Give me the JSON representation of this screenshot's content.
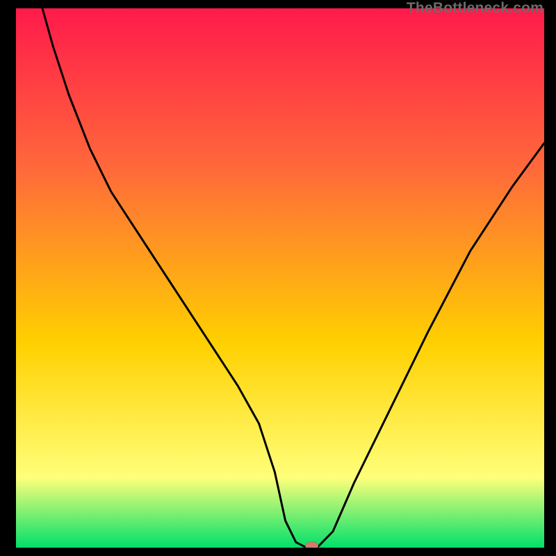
{
  "watermark": "TheBottleneck.com",
  "colors": {
    "gradient_top": "#ff1a4b",
    "gradient_mid1": "#ff6a3a",
    "gradient_mid2": "#ffd000",
    "gradient_mid3": "#ffff7a",
    "gradient_bottom": "#00e06a",
    "curve": "#000000",
    "marker_fill": "#d6796f",
    "marker_stroke": "#5aa14f",
    "frame": "#000000"
  },
  "chart_data": {
    "type": "line",
    "title": "",
    "xlabel": "",
    "ylabel": "",
    "xlim": [
      0,
      100
    ],
    "ylim": [
      0,
      100
    ],
    "grid": false,
    "legend": false,
    "series": [
      {
        "name": "bottleneck-curve",
        "x": [
          5,
          7,
          10,
          14,
          18,
          22,
          26,
          30,
          34,
          38,
          42,
          46,
          49,
          51,
          53,
          55,
          57,
          60,
          64,
          70,
          78,
          86,
          94,
          100
        ],
        "y": [
          100,
          93,
          84,
          74,
          66,
          60,
          54,
          48,
          42,
          36,
          30,
          23,
          14,
          5,
          1,
          0,
          0,
          3,
          12,
          24,
          40,
          55,
          67,
          75
        ]
      }
    ],
    "annotations": [
      {
        "name": "min-marker",
        "x": 56,
        "y": 0.3
      }
    ]
  }
}
